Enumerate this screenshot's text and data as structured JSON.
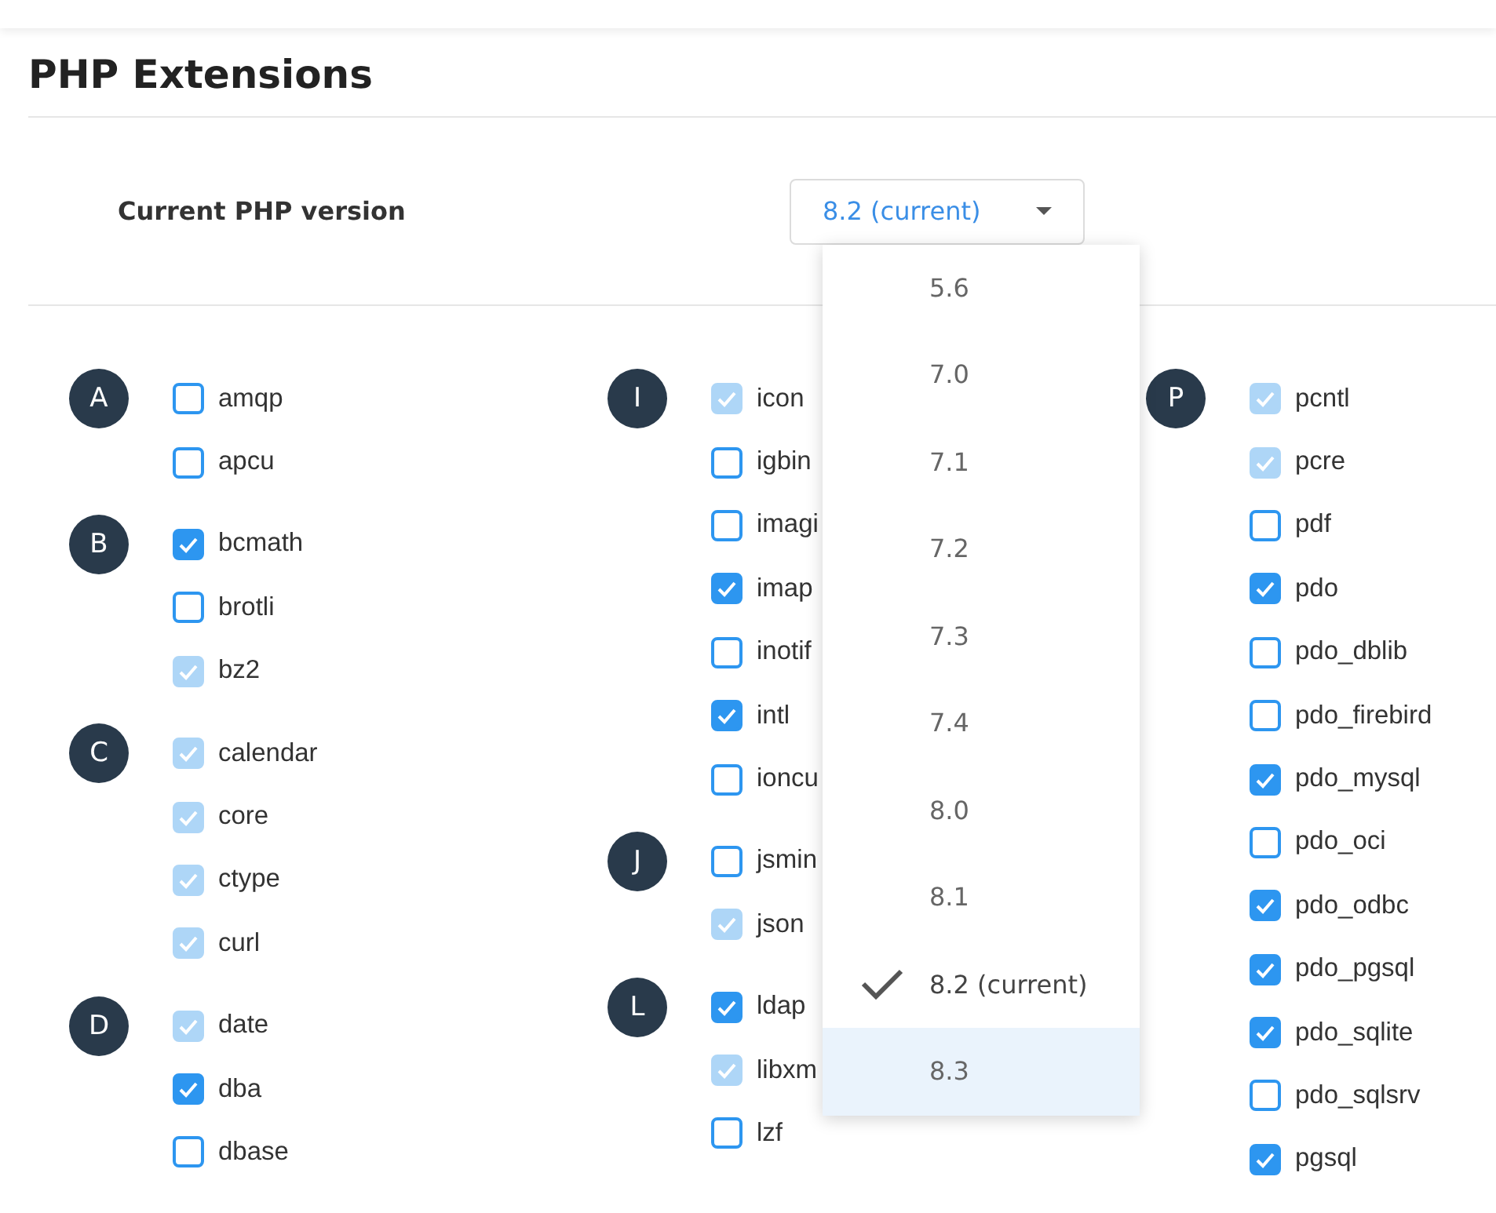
{
  "title": "PHP Extensions",
  "version": {
    "label": "Current PHP version",
    "value": "8.2 (current)",
    "expanded": true,
    "options": [
      {
        "label": "5.6",
        "selected": false,
        "highlighted": false
      },
      {
        "label": "7.0",
        "selected": false,
        "highlighted": false
      },
      {
        "label": "7.1",
        "selected": false,
        "highlighted": false
      },
      {
        "label": "7.2",
        "selected": false,
        "highlighted": false
      },
      {
        "label": "7.3",
        "selected": false,
        "highlighted": false
      },
      {
        "label": "7.4",
        "selected": false,
        "highlighted": false
      },
      {
        "label": "8.0",
        "selected": false,
        "highlighted": false
      },
      {
        "label": "8.1",
        "selected": false,
        "highlighted": false
      },
      {
        "label": "8.2 (current)",
        "selected": true,
        "highlighted": false
      },
      {
        "label": "8.3",
        "selected": false,
        "highlighted": true
      }
    ]
  },
  "columns": [
    {
      "groups": [
        {
          "letter": "A",
          "extensions": [
            {
              "name": "amqp",
              "checked": false,
              "disabled": false
            },
            {
              "name": "apcu",
              "checked": false,
              "disabled": false
            }
          ]
        },
        {
          "letter": "B",
          "extensions": [
            {
              "name": "bcmath",
              "checked": true,
              "disabled": false
            },
            {
              "name": "brotli",
              "checked": false,
              "disabled": false
            },
            {
              "name": "bz2",
              "checked": true,
              "disabled": true
            }
          ]
        },
        {
          "letter": "C",
          "extensions": [
            {
              "name": "calendar",
              "checked": true,
              "disabled": true
            },
            {
              "name": "core",
              "checked": true,
              "disabled": true
            },
            {
              "name": "ctype",
              "checked": true,
              "disabled": true
            },
            {
              "name": "curl",
              "checked": true,
              "disabled": true
            }
          ]
        },
        {
          "letter": "D",
          "extensions": [
            {
              "name": "date",
              "checked": true,
              "disabled": true
            },
            {
              "name": "dba",
              "checked": true,
              "disabled": false
            },
            {
              "name": "dbase",
              "checked": false,
              "disabled": false
            }
          ]
        }
      ]
    },
    {
      "groups": [
        {
          "letter": "I",
          "extensions": [
            {
              "name": "icon",
              "checked": true,
              "disabled": true
            },
            {
              "name": "igbin",
              "checked": false,
              "disabled": false
            },
            {
              "name": "imagi",
              "checked": false,
              "disabled": false
            },
            {
              "name": "imap",
              "checked": true,
              "disabled": false
            },
            {
              "name": "inotif",
              "checked": false,
              "disabled": false
            },
            {
              "name": "intl",
              "checked": true,
              "disabled": false
            },
            {
              "name": "ioncu",
              "checked": false,
              "disabled": false
            }
          ]
        },
        {
          "letter": "J",
          "extensions": [
            {
              "name": "jsmin",
              "checked": false,
              "disabled": false
            },
            {
              "name": "json",
              "checked": true,
              "disabled": true
            }
          ]
        },
        {
          "letter": "L",
          "extensions": [
            {
              "name": "ldap",
              "checked": true,
              "disabled": false
            },
            {
              "name": "libxm",
              "checked": true,
              "disabled": true
            },
            {
              "name": "lzf",
              "checked": false,
              "disabled": false
            }
          ]
        }
      ]
    },
    {
      "groups": [
        {
          "letter": "P",
          "extensions": [
            {
              "name": "pcntl",
              "checked": true,
              "disabled": true
            },
            {
              "name": "pcre",
              "checked": true,
              "disabled": true
            },
            {
              "name": "pdf",
              "checked": false,
              "disabled": false
            },
            {
              "name": "pdo",
              "checked": true,
              "disabled": false
            },
            {
              "name": "pdo_dblib",
              "checked": false,
              "disabled": false
            },
            {
              "name": "pdo_firebird",
              "checked": false,
              "disabled": false
            },
            {
              "name": "pdo_mysql",
              "checked": true,
              "disabled": false
            },
            {
              "name": "pdo_oci",
              "checked": false,
              "disabled": false
            },
            {
              "name": "pdo_odbc",
              "checked": true,
              "disabled": false
            },
            {
              "name": "pdo_pgsql",
              "checked": true,
              "disabled": false
            },
            {
              "name": "pdo_sqlite",
              "checked": true,
              "disabled": false
            },
            {
              "name": "pdo_sqlsrv",
              "checked": false,
              "disabled": false
            },
            {
              "name": "pgsql",
              "checked": true,
              "disabled": false
            }
          ]
        }
      ]
    }
  ]
}
